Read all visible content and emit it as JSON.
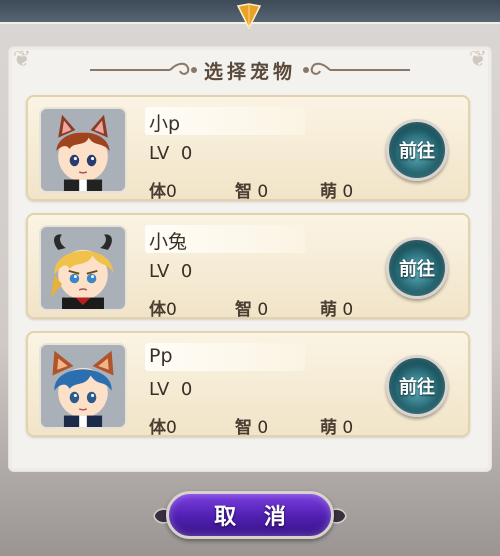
{
  "dialog": {
    "title": "选择宠物",
    "cancel_label": "取 消"
  },
  "pets": [
    {
      "name": "小p",
      "level_label": "LV",
      "level": "0",
      "stats": [
        {
          "key": "体",
          "value": "0"
        },
        {
          "key": "智",
          "value": "0"
        },
        {
          "key": "萌",
          "value": "0"
        }
      ],
      "go_label": "前往",
      "avatar": "brown-hair-cat-ears-boy"
    },
    {
      "name": "小兔",
      "level_label": "LV",
      "level": "0",
      "stats": [
        {
          "key": "体",
          "value": "0"
        },
        {
          "key": "智",
          "value": "0"
        },
        {
          "key": "萌",
          "value": "0"
        }
      ],
      "go_label": "前往",
      "avatar": "blonde-hair-devil-horns-boy"
    },
    {
      "name": "Pp",
      "level_label": "LV",
      "level": "0",
      "stats": [
        {
          "key": "体",
          "value": "0"
        },
        {
          "key": "智",
          "value": "0"
        },
        {
          "key": "萌",
          "value": "0"
        }
      ],
      "go_label": "前往",
      "avatar": "blue-hair-fox-ears-boy"
    }
  ],
  "colors": {
    "card_bg": "#f5ebd4",
    "go_button": "#1f5d68",
    "cancel_button": "#5a27c2",
    "title_text": "#5a4a3c"
  }
}
